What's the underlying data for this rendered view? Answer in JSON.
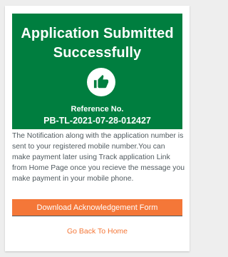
{
  "banner": {
    "title_line1": "Application Submitted",
    "title_line2": "Successfully",
    "icon": "thumbs-up-icon",
    "reference_label": "Reference No.",
    "reference_number": "PB-TL-2021-07-28-012427",
    "color": "#007e3f"
  },
  "message": "The Notification along with the application number is sent to your registered mobile number.You can make payment later using Track application Link from Home Page once you recieve the message you make payment in your mobile phone.",
  "actions": {
    "download_label": "Download Acknowledgement Form",
    "back_label": "Go Back To Home",
    "accent_color": "#f47738"
  }
}
